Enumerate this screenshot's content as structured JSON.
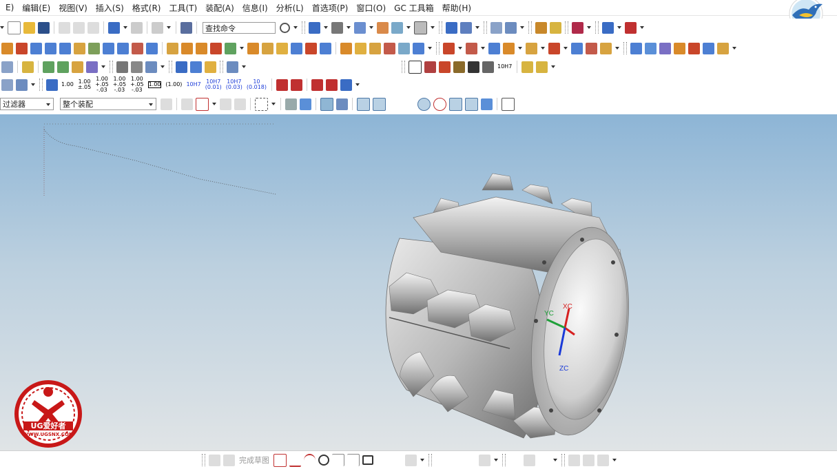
{
  "menu": [
    "E)",
    "编辑(E)",
    "视图(V)",
    "插入(S)",
    "格式(R)",
    "工具(T)",
    "装配(A)",
    "信息(I)",
    "分析(L)",
    "首选项(P)",
    "窗口(O)",
    "GC 工具箱",
    "帮助(H)"
  ],
  "toolbar": {
    "search_placeholder": "查找命令",
    "filter_label": "过滤器",
    "scope_label": "整个装配",
    "tolerance_labels": [
      "1.00",
      "1.00\n±.05",
      "1.00\n+.05\n-.03",
      "1.00\n+.05\n-.03",
      "1.00\n+.05\n-.03",
      "1.00",
      "(1.00)",
      "10H7",
      "10H7\n(0.01)",
      "10H7\n(0.03)",
      "10\n(0.018)"
    ],
    "mark_label": "10H7"
  },
  "bottom_toolbar": {
    "finish_sketch": "完成草图"
  },
  "view": {
    "axis_labels": {
      "x": "XC",
      "y": "YC",
      "z": "ZC"
    },
    "axis_colors": {
      "x": "#d62020",
      "y": "#1fa03a",
      "z": "#1a3ad8"
    }
  },
  "logo": {
    "title": "UG爱好者",
    "url": "WWW.UGSNX.COM"
  },
  "colors": {
    "accent": "#c81818",
    "bg_top": "#8db5d6",
    "bg_bottom": "#e0e4e6"
  }
}
